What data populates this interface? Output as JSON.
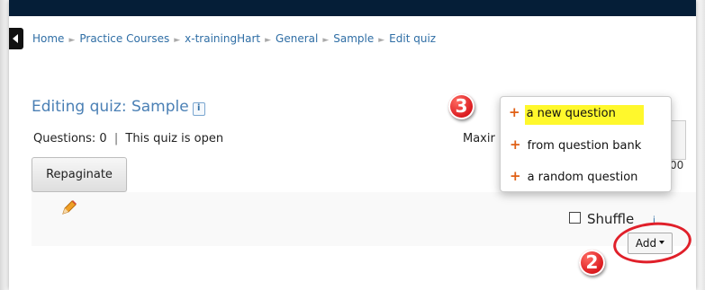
{
  "breadcrumb": [
    "Home",
    "Practice Courses",
    "x-trainingHart",
    "General",
    "Sample",
    "Edit quiz"
  ],
  "page": {
    "title": "Editing quiz: Sample",
    "help_icon_label": "i",
    "questions_count": "Questions: 0",
    "separator": "|",
    "quiz_open_status": "This quiz is open"
  },
  "toolbar": {
    "repaginate_label": "Repaginate",
    "maximum_label": "Maxir",
    "maximum_grade_visible": "00"
  },
  "section": {
    "shuffle_label": "Shuffle",
    "shuffle_checked": false,
    "add_label": "Add"
  },
  "add_menu": {
    "items": [
      {
        "label": "a new question",
        "highlighted": true
      },
      {
        "label": "from question bank",
        "highlighted": false
      },
      {
        "label": "a random question",
        "highlighted": false
      }
    ]
  },
  "annotations": {
    "step_2": "2",
    "step_3": "3",
    "annotation_color": "#e0202a",
    "highlight_color": "#fff82c"
  },
  "colors": {
    "link": "#2f6ea5",
    "title": "#4b80b5",
    "menu_plus": "#e06016",
    "navbar": "#051e37"
  }
}
